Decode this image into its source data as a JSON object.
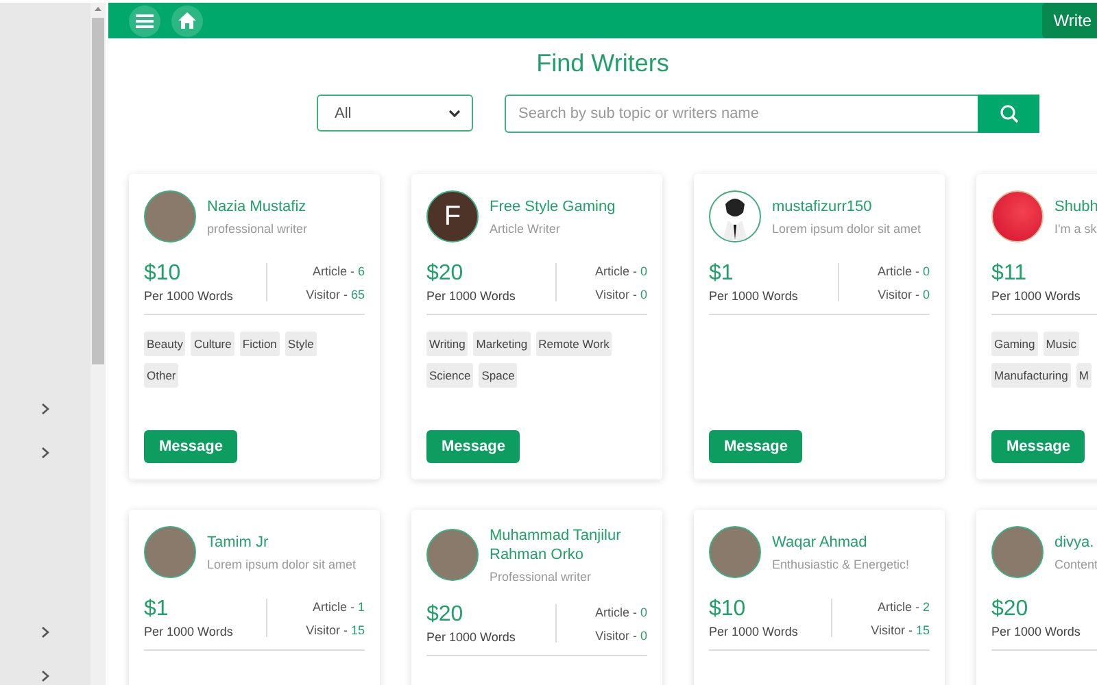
{
  "header": {
    "write_button": "Write"
  },
  "sidebar": {
    "items": [
      {
        "expandable": true
      },
      {
        "expandable": true
      },
      {
        "expandable": true
      },
      {
        "expandable": true
      }
    ]
  },
  "page_title": "Find Writers",
  "filter": {
    "value": "All"
  },
  "search": {
    "placeholder": "Search by sub topic or writers name"
  },
  "writers": [
    {
      "name": "Nazia Mustafiz",
      "subtitle": "professional writer",
      "avatar": {
        "kind": "photo"
      },
      "price": "$10",
      "per": "Per 1000 Words",
      "stats": [
        {
          "label": "Article -",
          "value": "6"
        },
        {
          "label": "Visitor -",
          "value": "65"
        }
      ],
      "tag_rows": [
        [
          "Beauty",
          "Culture",
          "Fiction",
          "Style"
        ],
        [
          "Other"
        ]
      ],
      "button": "Message"
    },
    {
      "name": "Free Style Gaming",
      "subtitle": "Article Writer",
      "avatar": {
        "kind": "letter",
        "letter": "F"
      },
      "price": "$20",
      "per": "Per 1000 Words",
      "stats": [
        {
          "label": "Article -",
          "value": "0"
        },
        {
          "label": "Visitor -",
          "value": "0"
        }
      ],
      "tag_rows": [
        [
          "Writing",
          "Marketing",
          "Remote Work"
        ],
        [
          "Science",
          "Space"
        ]
      ],
      "button": "Message"
    },
    {
      "name": "mustafizurr150",
      "subtitle": "Lorem ipsum dolor sit amet",
      "avatar": {
        "kind": "silhouette"
      },
      "price": "$1",
      "per": "Per 1000 Words",
      "stats": [
        {
          "label": "Article -",
          "value": "0"
        },
        {
          "label": "Visitor -",
          "value": "0"
        }
      ],
      "button": "Message"
    },
    {
      "name": "Shubh",
      "subtitle": "I'm a sk",
      "avatar": {
        "kind": "ball"
      },
      "price": "$11",
      "per": "Per 1000 Words",
      "tag_rows": [
        [
          "Gaming",
          "Music"
        ],
        [
          "Manufacturing",
          "M"
        ]
      ],
      "button": "Message"
    },
    {
      "name": "Tamim Jr",
      "subtitle": "Lorem ipsum dolor sit amet",
      "avatar": {
        "kind": "photo"
      },
      "price": "$1",
      "per": "Per 1000 Words",
      "stats": [
        {
          "label": "Article -",
          "value": "1"
        },
        {
          "label": "Visitor -",
          "value": "15"
        }
      ]
    },
    {
      "name": "Muhammad Tanjilur Rahman Orko",
      "subtitle": "Professional writer",
      "avatar": {
        "kind": "photo"
      },
      "price": "$20",
      "per": "Per 1000 Words",
      "stats": [
        {
          "label": "Article -",
          "value": "0"
        },
        {
          "label": "Visitor -",
          "value": "0"
        }
      ]
    },
    {
      "name": "Waqar Ahmad",
      "subtitle": "Enthusiastic & Energetic!",
      "avatar": {
        "kind": "photo"
      },
      "price": "$10",
      "per": "Per 1000 Words",
      "stats": [
        {
          "label": "Article -",
          "value": "2"
        },
        {
          "label": "Visitor -",
          "value": "15"
        }
      ]
    },
    {
      "name": "divya.",
      "subtitle": "Content",
      "avatar": {
        "kind": "photo"
      },
      "price": "$20",
      "per": "Per 1000 Words"
    }
  ]
}
